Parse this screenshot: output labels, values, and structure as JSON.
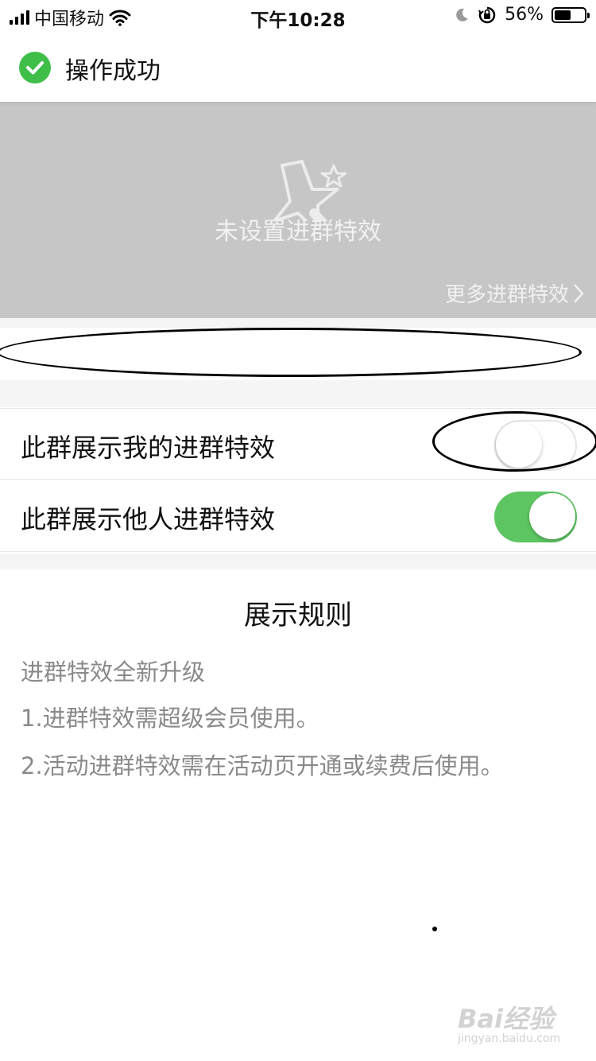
{
  "status_bar": {
    "carrier": "中国移动",
    "time": "下午10:28",
    "battery_percent": "56%",
    "battery_level": 0.56
  },
  "toast": {
    "text": "操作成功",
    "icon": "check-circle-icon",
    "color": "#3fbf4a"
  },
  "banner": {
    "message": "未设置进群特效",
    "more_link": "更多进群特效",
    "icon": "magic-wand-star-icon",
    "background": "#c6c6c6"
  },
  "settings": [
    {
      "label": "此群展示我的进群特效",
      "enabled": false
    },
    {
      "label": "此群展示他人进群特效",
      "enabled": true
    }
  ],
  "rules": {
    "title": "展示规则",
    "items": [
      "进群特效全新升级",
      "1.进群特效需超级会员使用。",
      "2.活动进群特效需在活动页开通或续费后使用。"
    ]
  },
  "watermark": {
    "logo": "Bai经验",
    "url": "jingyan.baidu.com"
  },
  "colors": {
    "toggle_on": "#5dc561",
    "accent_green": "#3fbf4a"
  }
}
